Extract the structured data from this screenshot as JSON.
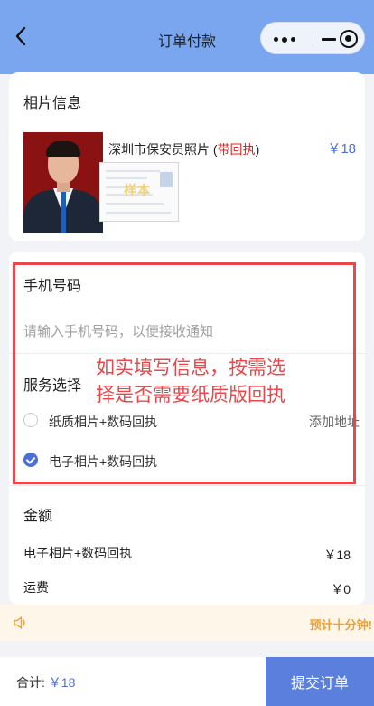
{
  "header": {
    "title": "订单付款"
  },
  "photo_info": {
    "section_title": "相片信息",
    "product_name": "深圳市保安员照片 (",
    "product_badge": "带回执",
    "product_name_end": ")",
    "price": "￥18",
    "receipt_stamp": "样本"
  },
  "phone": {
    "label": "手机号码",
    "placeholder": "请输入手机号码，以便接收通知"
  },
  "service": {
    "label": "服务选择",
    "options": [
      {
        "label": "纸质相片+数码回执",
        "checked": false
      },
      {
        "label": "电子相片+数码回执",
        "checked": true
      }
    ],
    "add_address": "添加地址"
  },
  "amount": {
    "label": "金额",
    "rows": [
      {
        "label": "电子相片+数码回执",
        "value": "￥18"
      },
      {
        "label": "运费",
        "value": "￥0"
      }
    ]
  },
  "annotation": {
    "line1": "如实填写信息，按需选",
    "line2": "择是否需要纸质版回执"
  },
  "notice": {
    "text": "预计十分钟!"
  },
  "footer": {
    "total_label": "合计: ",
    "total_value": "￥18",
    "submit_label": "提交订单"
  },
  "colors": {
    "accent": "#4c6fd6",
    "header": "#79a6ee",
    "annotation": "#e8474b"
  }
}
